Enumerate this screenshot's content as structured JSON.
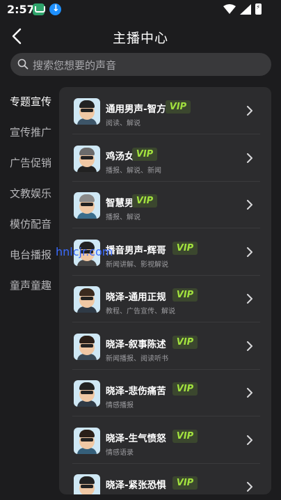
{
  "status_bar": {
    "time": "2:57"
  },
  "header": {
    "title": "主播中心"
  },
  "search": {
    "placeholder": "搜索您想要的声音"
  },
  "categories": [
    "专题宣传",
    "宣传推广",
    "广告促销",
    "文教娱乐",
    "模仿配音",
    "电台播报",
    "童声童趣"
  ],
  "active_category_index": 0,
  "vip_label": "VIP",
  "voices": [
    {
      "name": "通用男声-智方",
      "tags": "阅读、解说",
      "hair": "#222222",
      "shirt": "#3d5568"
    },
    {
      "name": "鸡汤女声",
      "tags": "播报、解说、新闻",
      "hair": "#6b6b6b",
      "shirt": "#222222"
    },
    {
      "name": "智慧男生",
      "tags": "播报、解说",
      "hair": "#8a8a8a",
      "shirt": "#3a6d8c"
    },
    {
      "name": "播音男声-辉哥",
      "tags": "新闻讲解、影视解说",
      "hair": "#222222",
      "shirt": "#444444"
    },
    {
      "name": "晓泽-通用正规",
      "tags": "教程、广告宣传、解说",
      "hair": "#3a2a1e",
      "shirt": "#2f3a46"
    },
    {
      "name": "晓泽-叙事陈述",
      "tags": "新闻播报、阅读听书",
      "hair": "#2a1f18",
      "shirt": "#3a4a56"
    },
    {
      "name": "晓泽-悲伤痛苦",
      "tags": "情感播报",
      "hair": "#222222",
      "shirt": "#2f3a46"
    },
    {
      "name": "晓泽-生气愤怒",
      "tags": "情感语录",
      "hair": "#2a1f18",
      "shirt": "#355f7a"
    },
    {
      "name": "晓泽-紧张恐惧",
      "tags": "",
      "hair": "#222222",
      "shirt": "#3d5568"
    }
  ],
  "watermark": "hnlcjr.com"
}
